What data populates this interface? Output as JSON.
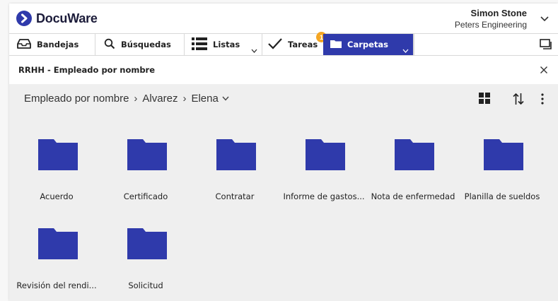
{
  "header": {
    "logo_text": "DocuWare",
    "user_name": "Simon Stone",
    "user_company": "Peters Engineering"
  },
  "tabs": [
    {
      "label": "Bandejas",
      "icon": "tray-icon"
    },
    {
      "label": "Búsquedas",
      "icon": "search-icon"
    },
    {
      "label": "Listas",
      "icon": "list-icon"
    },
    {
      "label": "Tareas",
      "icon": "check-icon",
      "badge": "1"
    },
    {
      "label": "Carpetas",
      "icon": "folder-icon",
      "active": true
    }
  ],
  "panel": {
    "title": "RRHH - Empleado por nombre"
  },
  "breadcrumb": [
    "Empleado por nombre",
    "Alvarez",
    "Elena"
  ],
  "folders": [
    "Acuerdo",
    "Certificado",
    "Contratar",
    "Informe de gastos...",
    "Nota de enfermedad",
    "Planilla de sueldos",
    "Revisión del rendi...",
    "Solicitud"
  ],
  "colors": {
    "accent": "#2f3aab",
    "badge": "#f5a623",
    "content_bg": "#efefef"
  }
}
